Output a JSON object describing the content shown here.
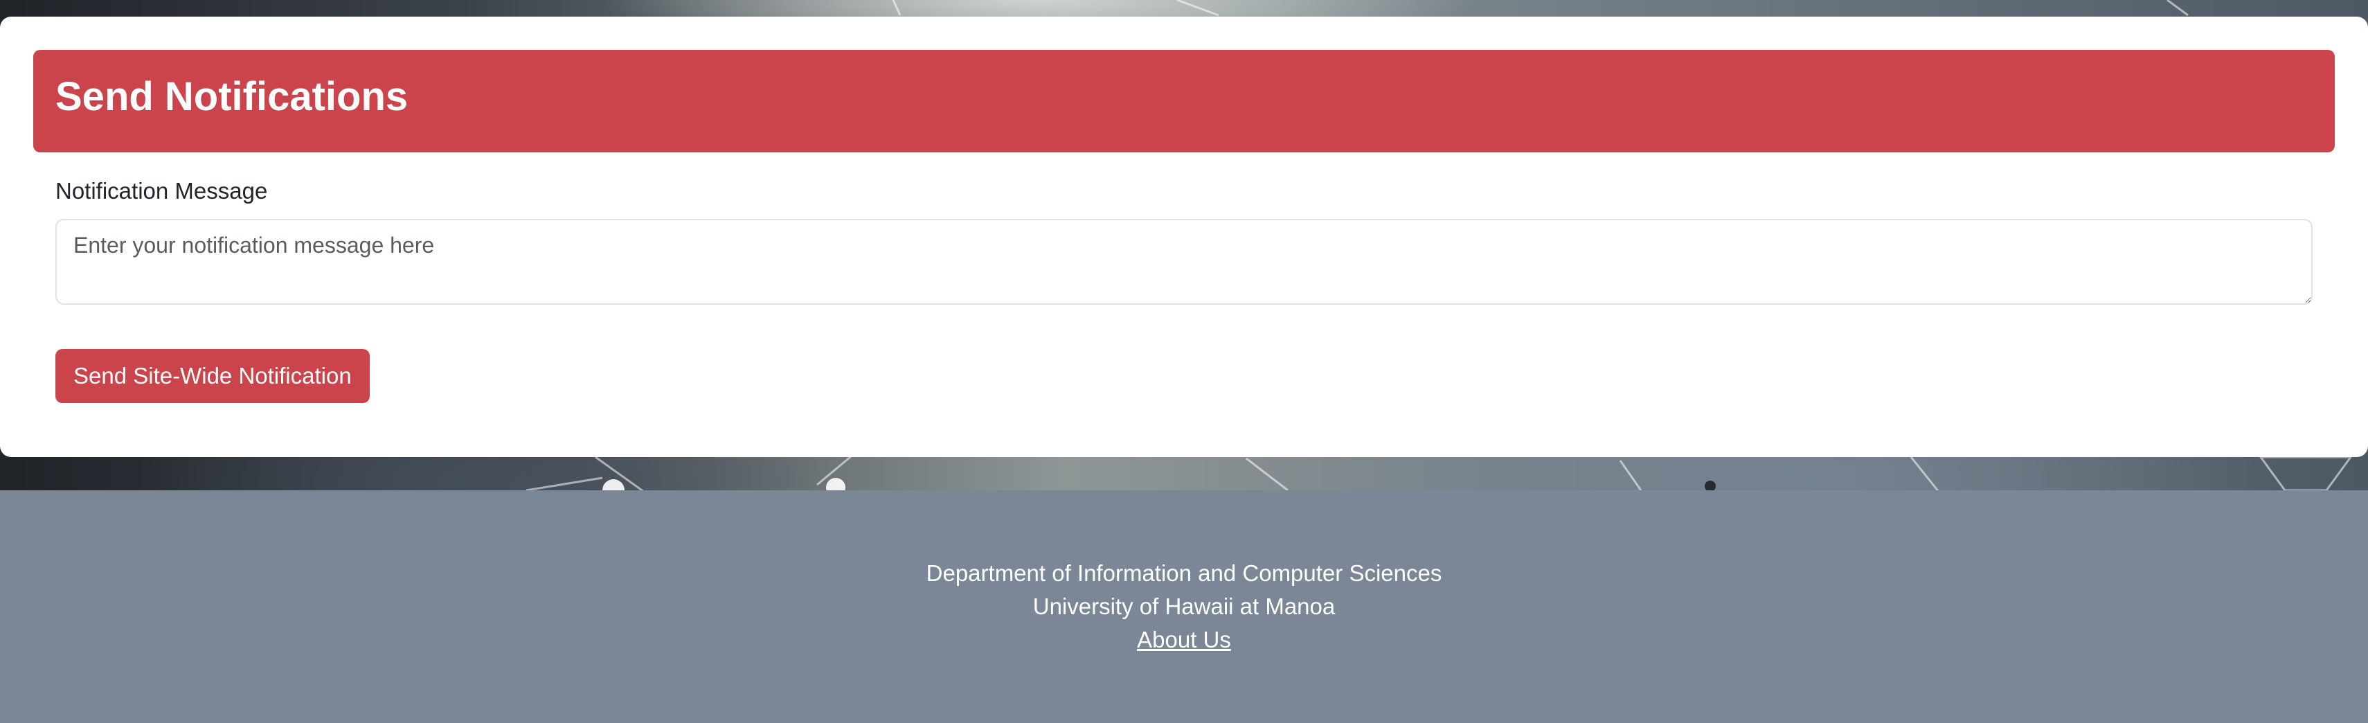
{
  "header": {
    "title": "Send Notifications"
  },
  "form": {
    "message_label": "Notification Message",
    "message_placeholder": "Enter your notification message here",
    "message_value": "",
    "submit_label": "Send Site-Wide Notification"
  },
  "footer": {
    "department": "Department of Information and Computer Sciences",
    "university": "University of Hawaii at Manoa",
    "about_link": "About Us"
  },
  "colors": {
    "accent": "#cc444b",
    "footer_bg": "#7b8796",
    "card_bg": "#ffffff"
  }
}
